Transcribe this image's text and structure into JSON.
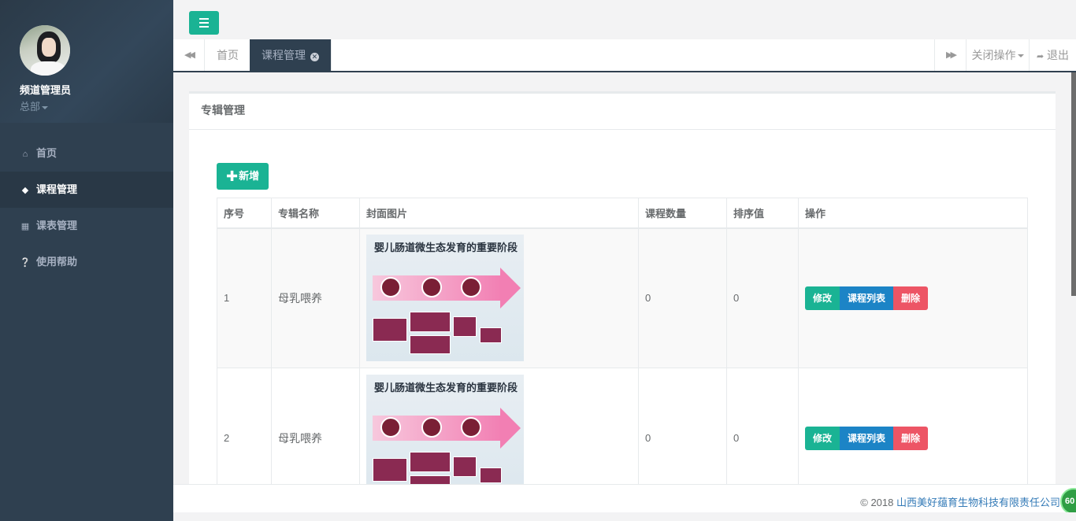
{
  "sidebar": {
    "profile": {
      "name": "频道管理员",
      "role": "总部"
    },
    "items": [
      {
        "label": "首页",
        "icon": "home-icon"
      },
      {
        "label": "课程管理",
        "icon": "tag-icon",
        "active": true
      },
      {
        "label": "课表管理",
        "icon": "calendar-icon"
      },
      {
        "label": "使用帮助",
        "icon": "question-circle-icon"
      }
    ]
  },
  "tabs": {
    "items": [
      {
        "label": "首页"
      },
      {
        "label": "课程管理",
        "active": true
      }
    ],
    "close_ops_label": "关闭操作",
    "logout_label": "退出"
  },
  "panel": {
    "title": "专辑管理",
    "add_label": "新增"
  },
  "table": {
    "headers": [
      "序号",
      "专辑名称",
      "封面图片",
      "课程数量",
      "排序值",
      "操作"
    ],
    "rows": [
      {
        "index": "1",
        "name": "母乳喂养",
        "cover_title": "婴儿肠道微生态发育的重要阶段",
        "course_count": "0",
        "sort": "0"
      },
      {
        "index": "2",
        "name": "母乳喂养",
        "cover_title": "婴儿肠道微生态发育的重要阶段",
        "course_count": "0",
        "sort": "0"
      }
    ],
    "actions": {
      "edit": "修改",
      "list": "课程列表",
      "delete": "删除"
    }
  },
  "footer": {
    "copy_prefix": "© 2018 ",
    "company": "山西美好蕴育生物科技有限责任公司",
    "badge": "60"
  },
  "colors": {
    "sidebar_bg": "#2f4050",
    "primary": "#1ab394",
    "info": "#1c84c6",
    "danger": "#ed5565"
  }
}
